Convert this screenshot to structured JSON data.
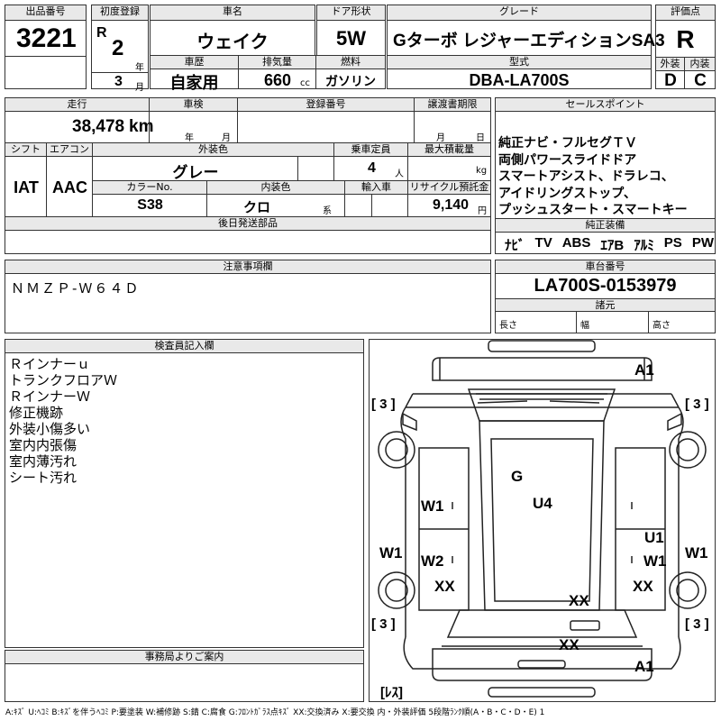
{
  "header": {
    "lot_label": "出品番号",
    "lot_number": "3221",
    "first_reg_label": "初度登録",
    "era": "R",
    "year": "2",
    "year_unit": "年",
    "month": "3",
    "month_unit": "月",
    "model_name_label": "車名",
    "model_name": "ウェイク",
    "door_label": "ドア形状",
    "door": "5W",
    "grade_label": "グレード",
    "grade": "Gターボ レジャーエディションSA3",
    "score_label": "評価点",
    "score": "R",
    "history_label": "車歴",
    "history": "自家用",
    "displacement_label": "排気量",
    "displacement": "660",
    "displacement_unit": "cc",
    "fuel_label": "燃料",
    "fuel": "ガソリン",
    "model_code_label": "型式",
    "model_code": "DBA-LA700S",
    "exterior_label": "外装",
    "interior_label": "内装",
    "exterior_grade": "D",
    "interior_grade": "C"
  },
  "details": {
    "mileage_label": "走行",
    "mileage": "38,478",
    "mileage_unit": "km",
    "inspection_label": "車検",
    "inspection_year_unit": "年",
    "inspection_month_unit": "月",
    "registration_label": "登録番号",
    "transfer_label": "譲渡書期限",
    "transfer_month_unit": "月",
    "transfer_day_unit": "日",
    "shift_label": "シフト",
    "shift": "IAT",
    "aircon_label": "エアコン",
    "aircon": "AAC",
    "color_label": "外装色",
    "color": "グレー",
    "capacity_label": "乗車定員",
    "capacity": "4",
    "capacity_unit": "人",
    "max_load_label": "最大積載量",
    "max_load_unit": "kg",
    "color_no_label": "カラーNo.",
    "color_no": "S38",
    "interior_color_label": "内装色",
    "interior_color": "クロ",
    "interior_color_suffix": "系",
    "import_label": "輸入車",
    "recycle_label": "リサイクル預託金",
    "recycle_amount": "9,140",
    "recycle_unit": "円",
    "later_parts_label": "後日発送部品"
  },
  "sales_points": {
    "label": "セールスポイント",
    "items": [
      "純正ナビ・フルセグＴＶ",
      "両側パワースライドドア",
      "スマートアシスト、ドラレコ、",
      "アイドリングストップ、",
      "プッシュスタート・スマートキー"
    ]
  },
  "equipment": {
    "label": "純正装備",
    "items": [
      "ﾅﾋﾞ",
      "TV",
      "ABS",
      "ｴｱB",
      "ｱﾙﾐ",
      "PS",
      "PW"
    ]
  },
  "notes": {
    "label": "注意事項欄",
    "text": "ＮＭＺＰ-Ｗ６４Ｄ"
  },
  "chassis": {
    "label": "車台番号",
    "number": "LA700S-0153979",
    "dims_label": "諸元",
    "length_label": "長さ",
    "width_label": "幅",
    "height_label": "高さ"
  },
  "inspector": {
    "label": "検査員記入欄",
    "lines": [
      "Ｒインナーｕ",
      "トランクフロアＷ",
      "ＲインナーＷ",
      "修正機跡",
      "外装小傷多い",
      "室内内張傷",
      "室内薄汚れ",
      "シート汚れ"
    ]
  },
  "office": {
    "label": "事務局よりご案内"
  },
  "diagram": {
    "marks": {
      "a1_top": "A1",
      "bracket_tl": "[ 3 ]",
      "bracket_tr": "[ 3 ]",
      "g": "G",
      "u4": "U4",
      "w1_left": "W1",
      "w1_left_outer": "W1",
      "w2": "W2",
      "u1": "U1",
      "w1_right": "W1",
      "w1_right_outer": "W1",
      "xx_left": "XX",
      "xx_right": "XX",
      "xx_center": "XX",
      "xx_bottom": "XX",
      "bracket_bl": "[ 3 ]",
      "bracket_br": "[ 3 ]",
      "a1_bottom": "A1",
      "less": "[ﾚｽ]"
    }
  },
  "legend": "A:ｷｽﾞ U:ﾍｺﾐ B:ｷｽﾞを伴うﾍｺﾐ P:要塗装 W:補修跡 S:錆 C:腐食 G:ﾌﾛﾝﾄｶﾞﾗｽ点ｷｽﾞ XX:交換済み X:要交換 内・外装評価 5段階ﾗﾝｸ順(A・B・C・D・E) 1"
}
